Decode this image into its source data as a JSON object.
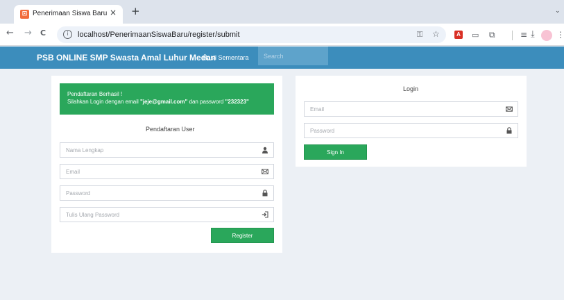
{
  "browser": {
    "tab_title": "Penerimaan Siswa Baru",
    "tab_favicon_glyph": "⊡",
    "tab_close": "×",
    "new_tab": "+",
    "tab_menu": "⌄",
    "url": "localhost/PenerimaanSiswaBaru/register/submit",
    "icons": {
      "back": "←",
      "forward": "→",
      "reload": "C",
      "site_info": "i",
      "password_key": "⚿",
      "bookmark": "☆",
      "pdf_ext": "A",
      "extensions": "⧉",
      "reading_list": "≡",
      "download": "⤓",
      "more": "⋮",
      "avatar": "●●"
    }
  },
  "navbar": {
    "brand": "PSB ONLINE SMP Swasta Amal Luhur Medan",
    "link": "Hasil Sementara",
    "search_placeholder": "Search",
    "bg_color": "#3c8dbc"
  },
  "register": {
    "alert": {
      "title": "Pendaftaran Berhasil !",
      "text_prefix": "Silahkan Login dengan email ",
      "email": "\"jeje@gmail.com\"",
      "text_middle": " dan password ",
      "password": "\"232323\"",
      "color": "#2aa75b"
    },
    "title": "Pendaftaran User",
    "fields": [
      {
        "placeholder": "Nama Lengkap",
        "icon": "user-icon"
      },
      {
        "placeholder": "Email",
        "icon": "envelope-icon"
      },
      {
        "placeholder": "Password",
        "icon": "lock-icon"
      },
      {
        "placeholder": "Tulis Ulang Password",
        "icon": "sign-in-icon"
      }
    ],
    "button": "Register"
  },
  "login": {
    "title": "Login",
    "fields": [
      {
        "placeholder": "Email",
        "icon": "envelope-icon"
      },
      {
        "placeholder": "Password",
        "icon": "lock-icon"
      }
    ],
    "button": "Sign In"
  },
  "colors": {
    "page_bg": "#ecf0f5",
    "success": "#2aa75b",
    "primary": "#3c8dbc"
  }
}
